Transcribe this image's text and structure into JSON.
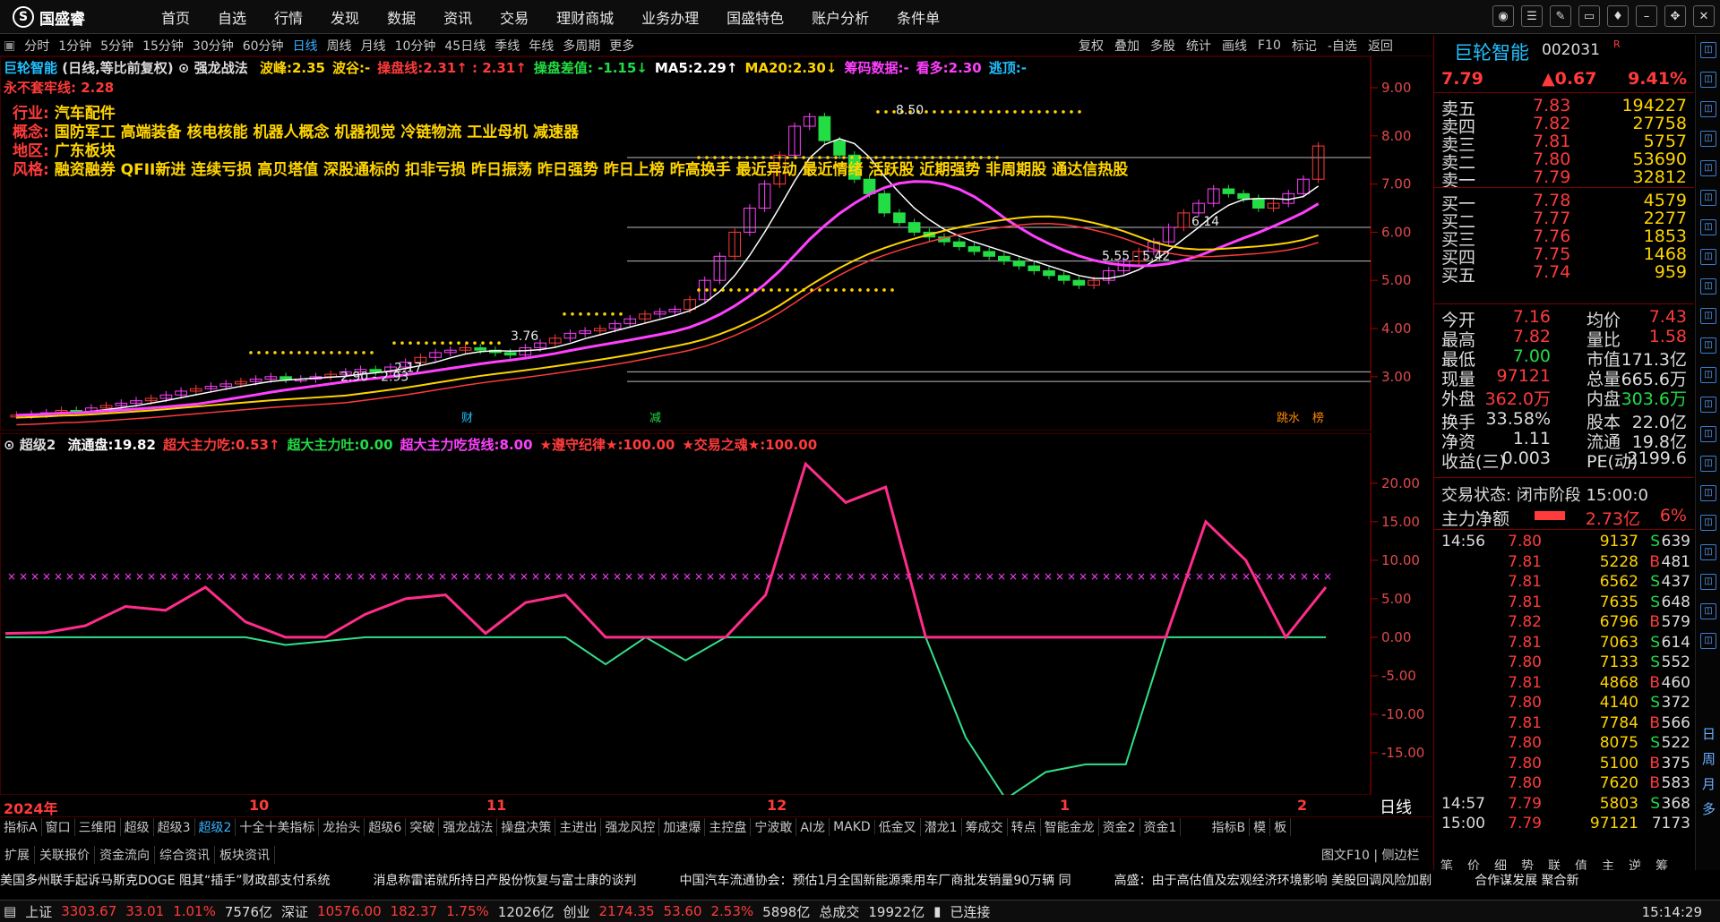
{
  "app": {
    "logo_text": "国盛睿",
    "menu": [
      "首页",
      "自选",
      "行情",
      "发现",
      "数据",
      "资讯",
      "交易",
      "理财商城",
      "业务办理",
      "国盛特色",
      "账户分析",
      "条件单"
    ]
  },
  "window_buttons": [
    "chat-icon",
    "settings-icon",
    "tools-icon",
    "screen-icon",
    "shirt-icon",
    "minimize-icon",
    "maximize-icon",
    "close-icon"
  ],
  "periods": [
    "分时",
    "1分钟",
    "5分钟",
    "15分钟",
    "30分钟",
    "60分钟",
    "日线",
    "周线",
    "月线",
    "10分钟",
    "45日线",
    "季线",
    "年线",
    "多周期",
    "更多"
  ],
  "active_period": "日线",
  "toolbar_right": [
    "复权",
    "叠加",
    "多股",
    "统计",
    "画线",
    "F10",
    "标记",
    "-自选",
    "返回"
  ],
  "chart_header": {
    "stock_name": "巨轮智能",
    "mode": "(日线,等比前复权)",
    "strategy": "强龙战法",
    "items": [
      {
        "label": "波峰:",
        "value": "2.35",
        "color": "#ffd400"
      },
      {
        "label": "波谷:",
        "value": "-",
        "color": "#ffd400"
      },
      {
        "label": "操盘线:",
        "value": "2.31↑ : 2.31↑",
        "color": "#ff3b3b"
      },
      {
        "label": "操盘差值",
        "value": ": -1.15↓",
        "color": "#22dd44"
      },
      {
        "label": "MA5:",
        "value": "2.29↑",
        "color": "#ffffff"
      },
      {
        "label": "MA20:",
        "value": "2.30↓",
        "color": "#ffd400"
      },
      {
        "label": "筹码数据:",
        "value": "-",
        "color": "#ff40ff"
      },
      {
        "label": "看多:",
        "value": "2.30",
        "color": "#ff40ff"
      },
      {
        "label": "逃顶:",
        "value": "-",
        "color": "#20c0ff"
      }
    ],
    "line2": "永不套牢线: 2.28"
  },
  "stock_info": {
    "industry_label": "行业:",
    "industry": "汽车配件",
    "concept_label": "概念:",
    "concept": "国防军工 高端装备 核电核能 机器人概念 机器视觉 冷链物流 工业母机 减速器",
    "region_label": "地区:",
    "region": "广东板块",
    "style_label": "风格:",
    "style": "融资融券 QFII新进 连续亏损 高贝塔值 深股通标的 扣非亏损 昨日振荡 昨日强势 昨日上榜 昨高换手 最近异动 最近情绪 活跃股 近期强势 非周期股 通达信热股"
  },
  "price_axis": [
    "9.00",
    "8.00",
    "7.00",
    "6.00",
    "5.00",
    "4.00",
    "3.00"
  ],
  "chart_annotations": [
    "8.50",
    "6.14",
    "5.55 - 5.42",
    "3.76",
    "2.90 - 2.93",
    "2.17"
  ],
  "chart_markers": [
    "财",
    "减",
    "跳水",
    "榜"
  ],
  "indicator_header": {
    "name": "超级2",
    "items": [
      {
        "label": "流通盘:",
        "value": "19.82",
        "color": "#ffffff"
      },
      {
        "label": "超大主力吃:",
        "value": "0.53↑",
        "color": "#ff3b3b"
      },
      {
        "label": "超大主力吐:",
        "value": "0.00",
        "color": "#22dd44"
      },
      {
        "label": "超大主力吃货线:",
        "value": "8.00",
        "color": "#ff40ff"
      },
      {
        "label": "★遵守纪律★:",
        "value": "100.00",
        "color": "#ff3b3b"
      },
      {
        "label": "★交易之魂★:",
        "value": "100.00",
        "color": "#ff3b3b"
      }
    ]
  },
  "indicator_axis": [
    "20.00",
    "15.00",
    "10.00",
    "5.00",
    "0.00",
    "-5.00",
    "-10.00",
    "-15.00"
  ],
  "x_axis": {
    "year": "2024年",
    "months": [
      "10",
      "11",
      "12",
      "1",
      "2"
    ],
    "period_label": "日线"
  },
  "chart_data": {
    "type": "line",
    "series": [
      {
        "values": [
          0.5,
          0.6,
          1.5,
          4.0,
          3.5,
          6.5,
          2.0,
          -1.0,
          -0.5,
          3.0,
          5.0,
          5.5,
          0.5,
          4.5,
          5.5,
          -3.5,
          0.0,
          -3.0,
          0.0,
          5.5,
          22.5,
          17.5,
          19.5,
          0.0,
          -13.0,
          -21.0,
          -17.5,
          -16.5,
          -16.5,
          0.0,
          15.0,
          10.0,
          0.0,
          6.5
        ]
      },
      {
        "values": [
          8,
          8
        ]
      }
    ],
    "ylim": [
      -20,
      23
    ]
  },
  "indicator_tabs": [
    "指标A",
    "窗口",
    "三维阳",
    "超级",
    "超级3",
    "超级2",
    "十全十美指标",
    "龙抬头",
    "超级6",
    "突破",
    "强龙战法",
    "操盘决策",
    "主进出",
    "强龙风控",
    "加速爆",
    "主控盘",
    "宁波敢",
    "AI龙",
    "MAKD",
    "低金叉",
    "潜龙1",
    "筹成交",
    "转点",
    "智能金龙",
    "资金2",
    "资金1"
  ],
  "active_indicator_tab": "超级2",
  "indicator_tabs_right": [
    "指标B",
    "模",
    "板"
  ],
  "ext_tabs": [
    "扩展",
    "关联报价",
    "资金流向",
    "综合资讯",
    "板块资讯"
  ],
  "side_tabs_bottom": [
    "图文F10",
    "侧边栏"
  ],
  "quote": {
    "name": "巨轮智能",
    "code": "002031",
    "flag": "R",
    "price": "7.79",
    "change": "▲0.67",
    "pct": "9.41%",
    "asks": [
      {
        "label": "卖五",
        "price": "7.83",
        "vol": "194227"
      },
      {
        "label": "卖四",
        "price": "7.82",
        "vol": "27758"
      },
      {
        "label": "卖三",
        "price": "7.81",
        "vol": "5757"
      },
      {
        "label": "卖二",
        "price": "7.80",
        "vol": "53690"
      },
      {
        "label": "卖一",
        "price": "7.79",
        "vol": "32812"
      }
    ],
    "bids": [
      {
        "label": "买一",
        "price": "7.78",
        "vol": "4579"
      },
      {
        "label": "买二",
        "price": "7.77",
        "vol": "2277"
      },
      {
        "label": "买三",
        "price": "7.76",
        "vol": "1853"
      },
      {
        "label": "买四",
        "price": "7.75",
        "vol": "1468"
      },
      {
        "label": "买五",
        "price": "7.74",
        "vol": "959"
      }
    ],
    "stats": [
      [
        "今开",
        "7.16",
        "均价",
        "7.43"
      ],
      [
        "最高",
        "7.82",
        "量比",
        "1.58"
      ],
      [
        "最低",
        "7.00",
        "市值",
        "171.3亿"
      ],
      [
        "现量",
        "97121",
        "总量",
        "665.6万"
      ],
      [
        "外盘",
        "362.0万",
        "内盘",
        "303.6万"
      ],
      [
        "换手",
        "33.58%",
        "股本",
        "22.0亿"
      ],
      [
        "净资",
        "1.11",
        "流通",
        "19.8亿"
      ],
      [
        "收益(三)",
        "0.003",
        "PE(动)",
        "2199.6"
      ]
    ],
    "trade_state": "交易状态: 闭市阶段 15:00:0",
    "main_net_label": "主力净额",
    "main_net_value": "2.73亿",
    "main_net_pct": "6%",
    "ticks": [
      {
        "time": "14:56",
        "price": "7.80",
        "vol": "9137",
        "side": "S",
        "n": "639"
      },
      {
        "time": "",
        "price": "7.81",
        "vol": "5228",
        "side": "B",
        "n": "481"
      },
      {
        "time": "",
        "price": "7.81",
        "vol": "6562",
        "side": "S",
        "n": "437"
      },
      {
        "time": "",
        "price": "7.81",
        "vol": "7635",
        "side": "S",
        "n": "648"
      },
      {
        "time": "",
        "price": "7.82",
        "vol": "6796",
        "side": "B",
        "n": "579"
      },
      {
        "time": "",
        "price": "7.81",
        "vol": "7063",
        "side": "S",
        "n": "614"
      },
      {
        "time": "",
        "price": "7.80",
        "vol": "7133",
        "side": "S",
        "n": "552"
      },
      {
        "time": "",
        "price": "7.81",
        "vol": "4868",
        "side": "B",
        "n": "460"
      },
      {
        "time": "",
        "price": "7.80",
        "vol": "4140",
        "side": "S",
        "n": "372"
      },
      {
        "time": "",
        "price": "7.81",
        "vol": "7784",
        "side": "B",
        "n": "566"
      },
      {
        "time": "",
        "price": "7.80",
        "vol": "8075",
        "side": "S",
        "n": "522"
      },
      {
        "time": "",
        "price": "7.80",
        "vol": "5100",
        "side": "B",
        "n": "375"
      },
      {
        "time": "",
        "price": "7.80",
        "vol": "7620",
        "side": "B",
        "n": "583"
      },
      {
        "time": "14:57",
        "price": "7.79",
        "vol": "5803",
        "side": "S",
        "n": "368"
      },
      {
        "time": "15:00",
        "price": "7.79",
        "vol": "97121",
        "side": "",
        "n": "7173"
      }
    ],
    "bottom_tabs": [
      "笔",
      "价",
      "细",
      "势",
      "联",
      "值",
      "主",
      "逆",
      "筹"
    ]
  },
  "side_icons": [
    "expand-icon",
    "up-icon",
    "list-icon",
    "chart-icon",
    "bar-icon",
    "trend-icon",
    "stock-icon",
    "grid-icon",
    "money-icon",
    "rank-icon",
    "note-icon",
    "signal-icon",
    "move-icon",
    "search-icon",
    "pen-icon",
    "plus-icon",
    "pin-icon",
    "hand-icon",
    "fund-icon",
    "bond-icon",
    "app-icon"
  ],
  "side_labels": [
    "日",
    "周",
    "月",
    "多"
  ],
  "news": [
    "美国多州联手起诉马斯克DOGE 阻其“插手”财政部支付系统",
    "消息称雷诺就所持日产股份恢复与富士康的谈判",
    "中国汽车流通协会：预估1月全国新能源乘用车厂商批发销量90万辆 同",
    "高盛：由于高估值及宏观经济环境影响 美股回调风险加剧",
    "合作谋发展 聚合新"
  ],
  "status": {
    "sh_label": "上证",
    "sh_value": "3303.67",
    "sh_chg": "33.01",
    "sh_pct": "1.01%",
    "sh_amt": "7576亿",
    "sz_label": "深证",
    "sz_value": "10576.00",
    "sz_chg": "182.37",
    "sz_pct": "1.75%",
    "sz_amt": "12026亿",
    "cy_label": "创业",
    "cy_value": "2174.35",
    "cy_chg": "53.60",
    "cy_pct": "2.53%",
    "cy_amt": "5898亿",
    "total_label": "总成交",
    "total": "19922亿",
    "conn": "已连接",
    "time": "15:14:29"
  }
}
